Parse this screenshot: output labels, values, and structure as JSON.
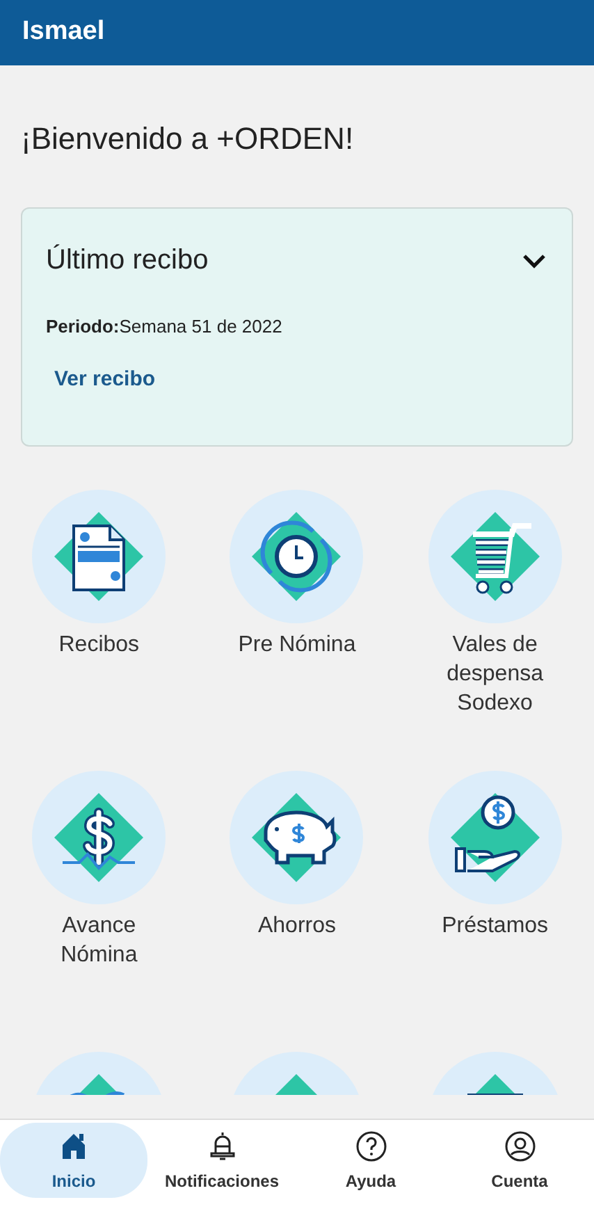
{
  "header": {
    "title": "Ismael"
  },
  "welcome": "¡Bienvenido a +ORDEN!",
  "receipt_card": {
    "title": "Último recibo",
    "expanded": true,
    "period": "**Periodo:**Semana 51 de 2022",
    "link": "Ver recibo"
  },
  "tiles": [
    {
      "kind": "receipt",
      "label": "Recibos"
    },
    {
      "kind": "clock",
      "label": "Pre Nómina"
    },
    {
      "kind": "cart",
      "label": "Vales de despensa Sodexo"
    },
    {
      "kind": "dollar",
      "label": "Avance Nómina"
    },
    {
      "kind": "piggy",
      "label": "Ahorros"
    },
    {
      "kind": "hand",
      "label": "Préstamos"
    },
    {
      "kind": "wave"
    },
    {
      "kind": "plain"
    },
    {
      "kind": "tray"
    }
  ],
  "nav": [
    {
      "kind": "home",
      "label": "Inicio",
      "selected": true
    },
    {
      "kind": "bell",
      "label": "Notificaciones",
      "selected": false
    },
    {
      "kind": "help",
      "label": "Ayuda",
      "selected": false
    },
    {
      "kind": "account",
      "label": "Cuenta",
      "selected": false
    }
  ]
}
